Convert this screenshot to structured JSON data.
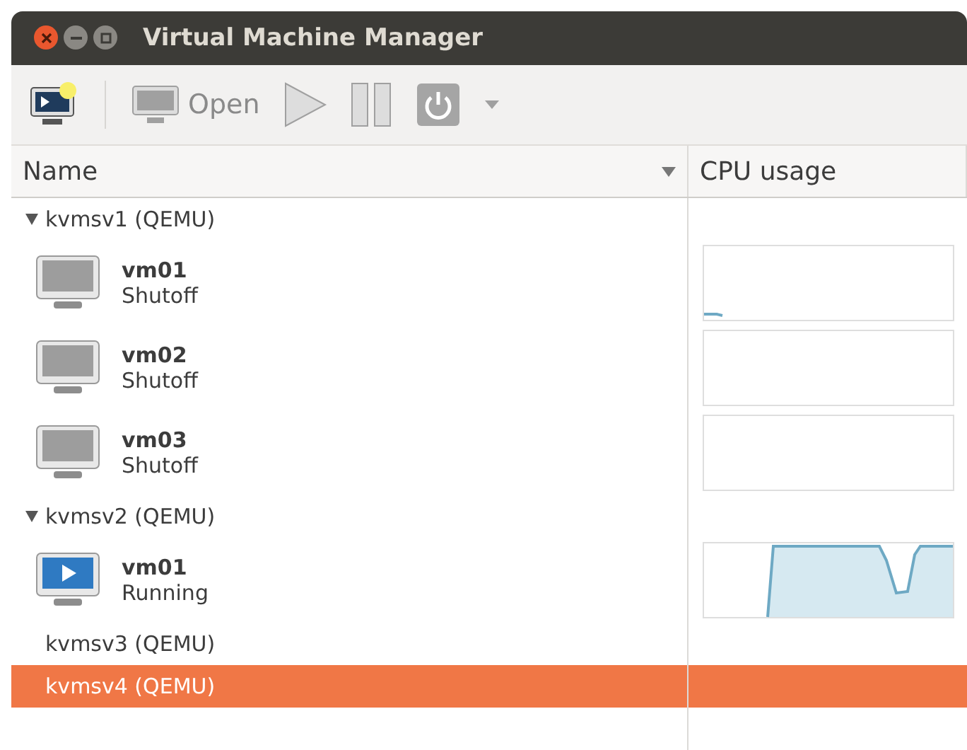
{
  "window": {
    "title": "Virtual Machine Manager"
  },
  "toolbar": [
    {
      "kind": "new",
      "disabled": false
    },
    {
      "kind": "open",
      "label": "Open",
      "disabled": true
    },
    {
      "kind": "run",
      "disabled": true
    },
    {
      "kind": "pause",
      "disabled": true
    },
    {
      "kind": "shutdown",
      "disabled": true
    },
    {
      "kind": "menu",
      "disabled": true
    }
  ],
  "table": {
    "columns": [
      "Name",
      "CPU usage"
    ],
    "hosts": [
      {
        "name": "kvmsv1 (QEMU)",
        "expanded": true,
        "selected": false,
        "children": [
          {
            "name": "vm01",
            "status": "Shutoff",
            "kind": "shutoff",
            "cpu_graph": {
              "kind": "idle"
            }
          },
          {
            "name": "vm02",
            "status": "Shutoff",
            "kind": "shutoff",
            "cpu_graph": {
              "kind": "empty"
            }
          },
          {
            "name": "vm03",
            "status": "Shutoff",
            "kind": "shutoff",
            "cpu_graph": {
              "kind": "empty"
            }
          }
        ]
      },
      {
        "name": "kvmsv2 (QEMU)",
        "expanded": true,
        "selected": false,
        "children": [
          {
            "name": "vm01",
            "status": "Running",
            "kind": "running",
            "cpu_graph": {
              "kind": "busy"
            }
          }
        ]
      },
      {
        "name": "kvmsv3 (QEMU)",
        "expanded": false,
        "selected": false
      },
      {
        "name": "kvmsv4 (QEMU)",
        "expanded": false,
        "selected": true
      }
    ]
  }
}
